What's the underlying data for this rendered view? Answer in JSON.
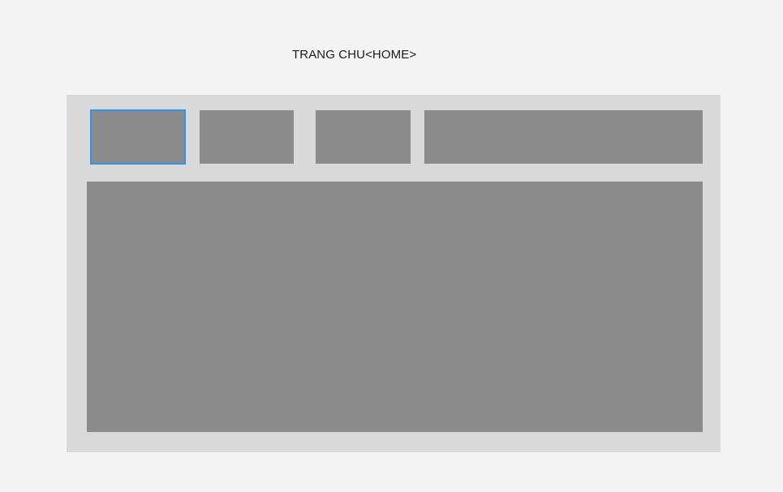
{
  "header": {
    "title": "TRANG CHU<HOME>"
  },
  "colors": {
    "page_background": "#f4f4f4",
    "frame_background": "#d9d9d9",
    "placeholder_fill": "#8c8c8c",
    "selection_outline": "#2d95ee"
  },
  "nav": {
    "items": [
      {
        "label": "",
        "selected": true
      },
      {
        "label": "",
        "selected": false
      },
      {
        "label": "",
        "selected": false
      },
      {
        "label": "",
        "selected": false
      }
    ]
  },
  "main": {
    "content_label": ""
  }
}
